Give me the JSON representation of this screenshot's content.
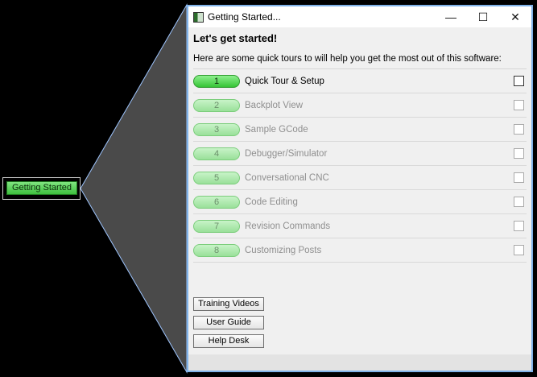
{
  "launcher": {
    "label": "Getting Started"
  },
  "window": {
    "title": "Getting Started...",
    "controls": {
      "minimize": "—",
      "maximize": "☐",
      "close": "✕"
    },
    "heading": "Let's get started!",
    "subheading": "Here are some quick tours to will help you get the most out of this software:",
    "tours": [
      {
        "number": "1",
        "label": "Quick Tour & Setup",
        "active": true,
        "checked": false
      },
      {
        "number": "2",
        "label": "Backplot View",
        "active": false,
        "checked": false
      },
      {
        "number": "3",
        "label": "Sample GCode",
        "active": false,
        "checked": false
      },
      {
        "number": "4",
        "label": "Debugger/Simulator",
        "active": false,
        "checked": false
      },
      {
        "number": "5",
        "label": "Conversational CNC",
        "active": false,
        "checked": false
      },
      {
        "number": "6",
        "label": "Code Editing",
        "active": false,
        "checked": false
      },
      {
        "number": "7",
        "label": "Revision Commands",
        "active": false,
        "checked": false
      },
      {
        "number": "8",
        "label": "Customizing Posts",
        "active": false,
        "checked": false
      }
    ],
    "buttons": {
      "training_videos": "Training Videos",
      "user_guide": "User Guide",
      "help_desk": "Help Desk"
    }
  },
  "colors": {
    "accent_green": "#35c435",
    "window_border": "#7fb2e8",
    "callout_fill": "#4a4a4a"
  }
}
